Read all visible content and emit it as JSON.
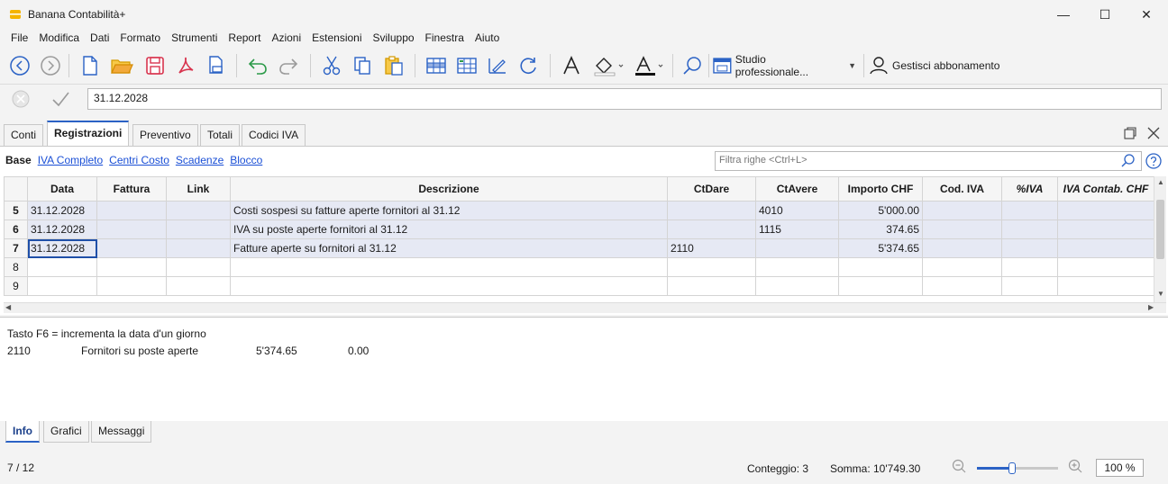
{
  "window": {
    "title": "Banana Contabilità+",
    "minimize": "—",
    "maximize": "☐",
    "close": "✕"
  },
  "menu": [
    "File",
    "Modifica",
    "Dati",
    "Formato",
    "Strumenti",
    "Report",
    "Azioni",
    "Estensioni",
    "Sviluppo",
    "Finestra",
    "Aiuto"
  ],
  "toolbar": {
    "icons": [
      "back-icon",
      "forward-icon",
      "new-document-icon",
      "open-folder-icon",
      "save-icon",
      "pdf-icon",
      "print-preview-icon",
      "undo-icon",
      "redo-icon",
      "cut-icon",
      "copy-icon",
      "paste-icon",
      "add-rows-icon",
      "insert-rows-icon",
      "edit-icon",
      "recalculate-icon",
      "font-icon",
      "fill-color-icon",
      "text-color-icon",
      "search-icon",
      "window-icon",
      "user-icon"
    ],
    "studio_label": "Studio professionale...",
    "account_label": "Gestisci abbonamento"
  },
  "editline": {
    "value": "31.12.2028"
  },
  "tabs": [
    "Conti",
    "Registrazioni",
    "Preventivo",
    "Totali",
    "Codici IVA"
  ],
  "active_tab": "Registrazioni",
  "views": {
    "base": "Base",
    "links": [
      "IVA Completo",
      "Centri Costo",
      "Scadenze",
      "Blocco"
    ]
  },
  "filter": {
    "placeholder": "Filtra righe <Ctrl+L>"
  },
  "grid": {
    "columns": [
      "Data",
      "Fattura",
      "Link",
      "Descrizione",
      "CtDare",
      "CtAvere",
      "Importo CHF",
      "Cod. IVA",
      "%IVA",
      "IVA Contab. CHF"
    ],
    "rows": [
      {
        "num": "5",
        "data": "31.12.2028",
        "fattura": "",
        "link": "",
        "descrizione": "Costi sospesi su fatture aperte fornitori al 31.12",
        "ctdare": "",
        "ctavere": "4010",
        "importo": "5'000.00",
        "codiva": "",
        "pctiva": "",
        "ivacontab": ""
      },
      {
        "num": "6",
        "data": "31.12.2028",
        "fattura": "",
        "link": "",
        "descrizione": "IVA su poste aperte fornitori al 31.12",
        "ctdare": "",
        "ctavere": "1115",
        "importo": "374.65",
        "codiva": "",
        "pctiva": "",
        "ivacontab": ""
      },
      {
        "num": "7",
        "data": "31.12.2028",
        "fattura": "",
        "link": "",
        "descrizione": "Fatture aperte su fornitori al 31.12",
        "ctdare": "2110",
        "ctavere": "",
        "importo": "5'374.65",
        "codiva": "",
        "pctiva": "",
        "ivacontab": ""
      },
      {
        "num": "8",
        "data": "",
        "fattura": "",
        "link": "",
        "descrizione": "",
        "ctdare": "",
        "ctavere": "",
        "importo": "",
        "codiva": "",
        "pctiva": "",
        "ivacontab": ""
      },
      {
        "num": "9",
        "data": "",
        "fattura": "",
        "link": "",
        "descrizione": "",
        "ctdare": "",
        "ctavere": "",
        "importo": "",
        "codiva": "",
        "pctiva": "",
        "ivacontab": ""
      }
    ]
  },
  "info": {
    "hint": "Tasto F6 = incrementa la data d'un giorno",
    "account": "2110",
    "account_desc": "Fornitori su poste aperte",
    "amount": "5'374.65",
    "balance": "0.00"
  },
  "bottom_tabs": [
    "Info",
    "Grafici",
    "Messaggi"
  ],
  "status": {
    "position": "7 / 12",
    "count": "Conteggio: 3",
    "sum": "Somma: 10'749.30",
    "zoom": "100 %",
    "zoom_level": 1.0
  },
  "colors": {
    "accent": "#2b62c5",
    "link": "#1a4fd6",
    "row_fill": "#e6e9f4",
    "logo": "#f5b400"
  }
}
